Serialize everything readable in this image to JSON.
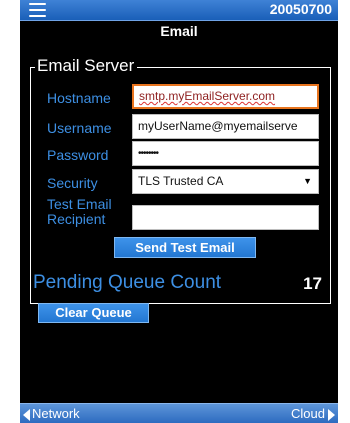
{
  "header": {
    "device_id": "20050700",
    "title": "Email"
  },
  "form": {
    "legend": "Email Server",
    "hostname": {
      "label": "Hostname",
      "value": "smtp.myEmailServer.com"
    },
    "username": {
      "label": "Username",
      "value": "myUserName@myemailserve"
    },
    "password": {
      "label": "Password",
      "value": "••••••••"
    },
    "security": {
      "label": "Security",
      "value": "TLS Trusted CA"
    },
    "test_recipient": {
      "label_line1": "Test Email",
      "label_line2": "Recipient",
      "value": ""
    },
    "send_test_label": "Send Test Email"
  },
  "queue": {
    "label": "Pending Queue Count",
    "count": "17",
    "clear_label": "Clear Queue"
  },
  "footer": {
    "left": "Network",
    "right": "Cloud"
  },
  "colors": {
    "accent": "#3d8fe3",
    "bar": "#2d6bc0",
    "focus": "#e8741e",
    "background": "#000000"
  }
}
